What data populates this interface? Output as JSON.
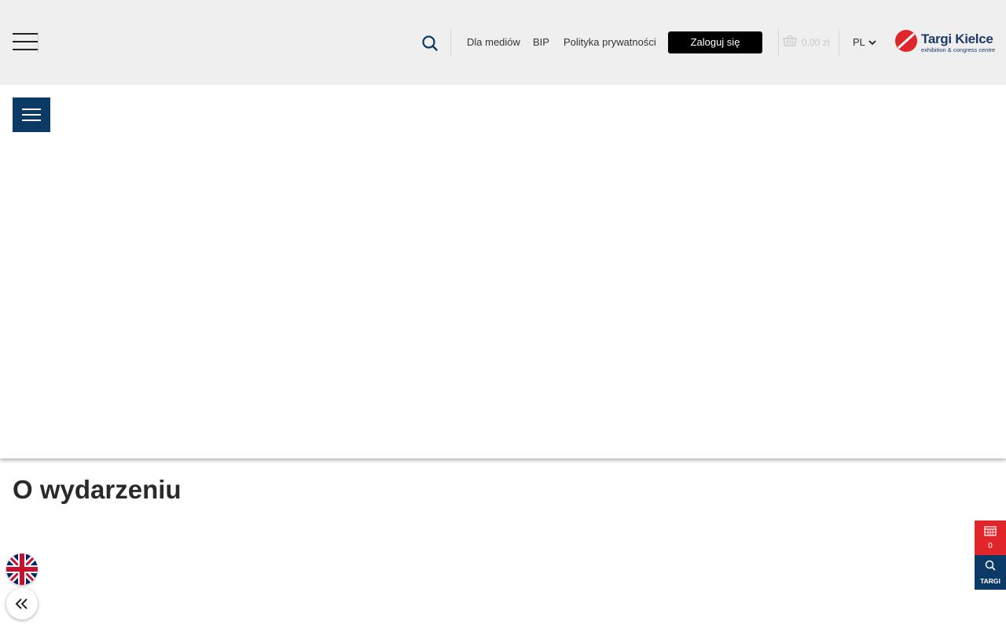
{
  "header": {
    "links": [
      "Dla mediów",
      "BIP",
      "Polityka prywatności"
    ],
    "login_label": "Zaloguj się",
    "cart_amount": "0,00 zł",
    "language": "PL",
    "logo_title": "Targi Kielce",
    "logo_subtitle": "exhibition & congress centre"
  },
  "main": {
    "section_title": "O wydarzeniu"
  },
  "side_widget": {
    "calendar_count": "0",
    "search_label": "TARGI"
  },
  "colors": {
    "navy": "#0b3a66",
    "red": "#e0262b",
    "header_bg": "#efefef"
  },
  "icons": [
    "menu-icon",
    "search-icon",
    "cart-icon",
    "chevron-down-icon",
    "calendar-icon",
    "uk-flag-icon",
    "double-chevron-left-icon"
  ]
}
